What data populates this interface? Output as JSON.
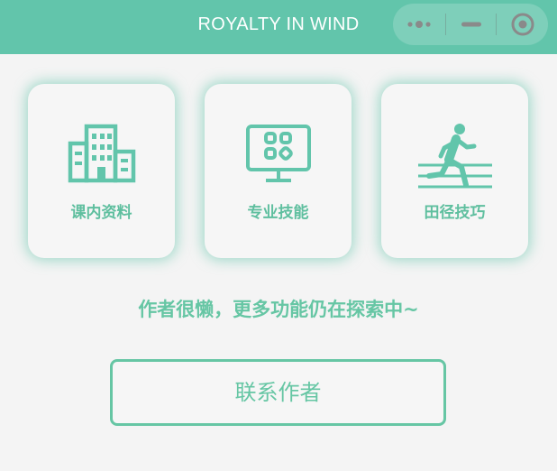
{
  "header": {
    "title": "ROYALTY IN WIND",
    "capsule": {
      "more_icon": "more-dots-icon",
      "min_icon": "minimize-icon",
      "close_icon": "close-circle-icon"
    }
  },
  "cards": [
    {
      "label": "课内资料",
      "icon": "building-icon"
    },
    {
      "label": "专业技能",
      "icon": "monitor-apps-icon"
    },
    {
      "label": "田径技巧",
      "icon": "runner-icon"
    }
  ],
  "notice": "作者很懒，更多功能仍在探索中~",
  "contact_button": "联系作者",
  "colors": {
    "accent": "#62c5ab",
    "background": "#f4f4f4",
    "card": "#f6f6f6"
  }
}
